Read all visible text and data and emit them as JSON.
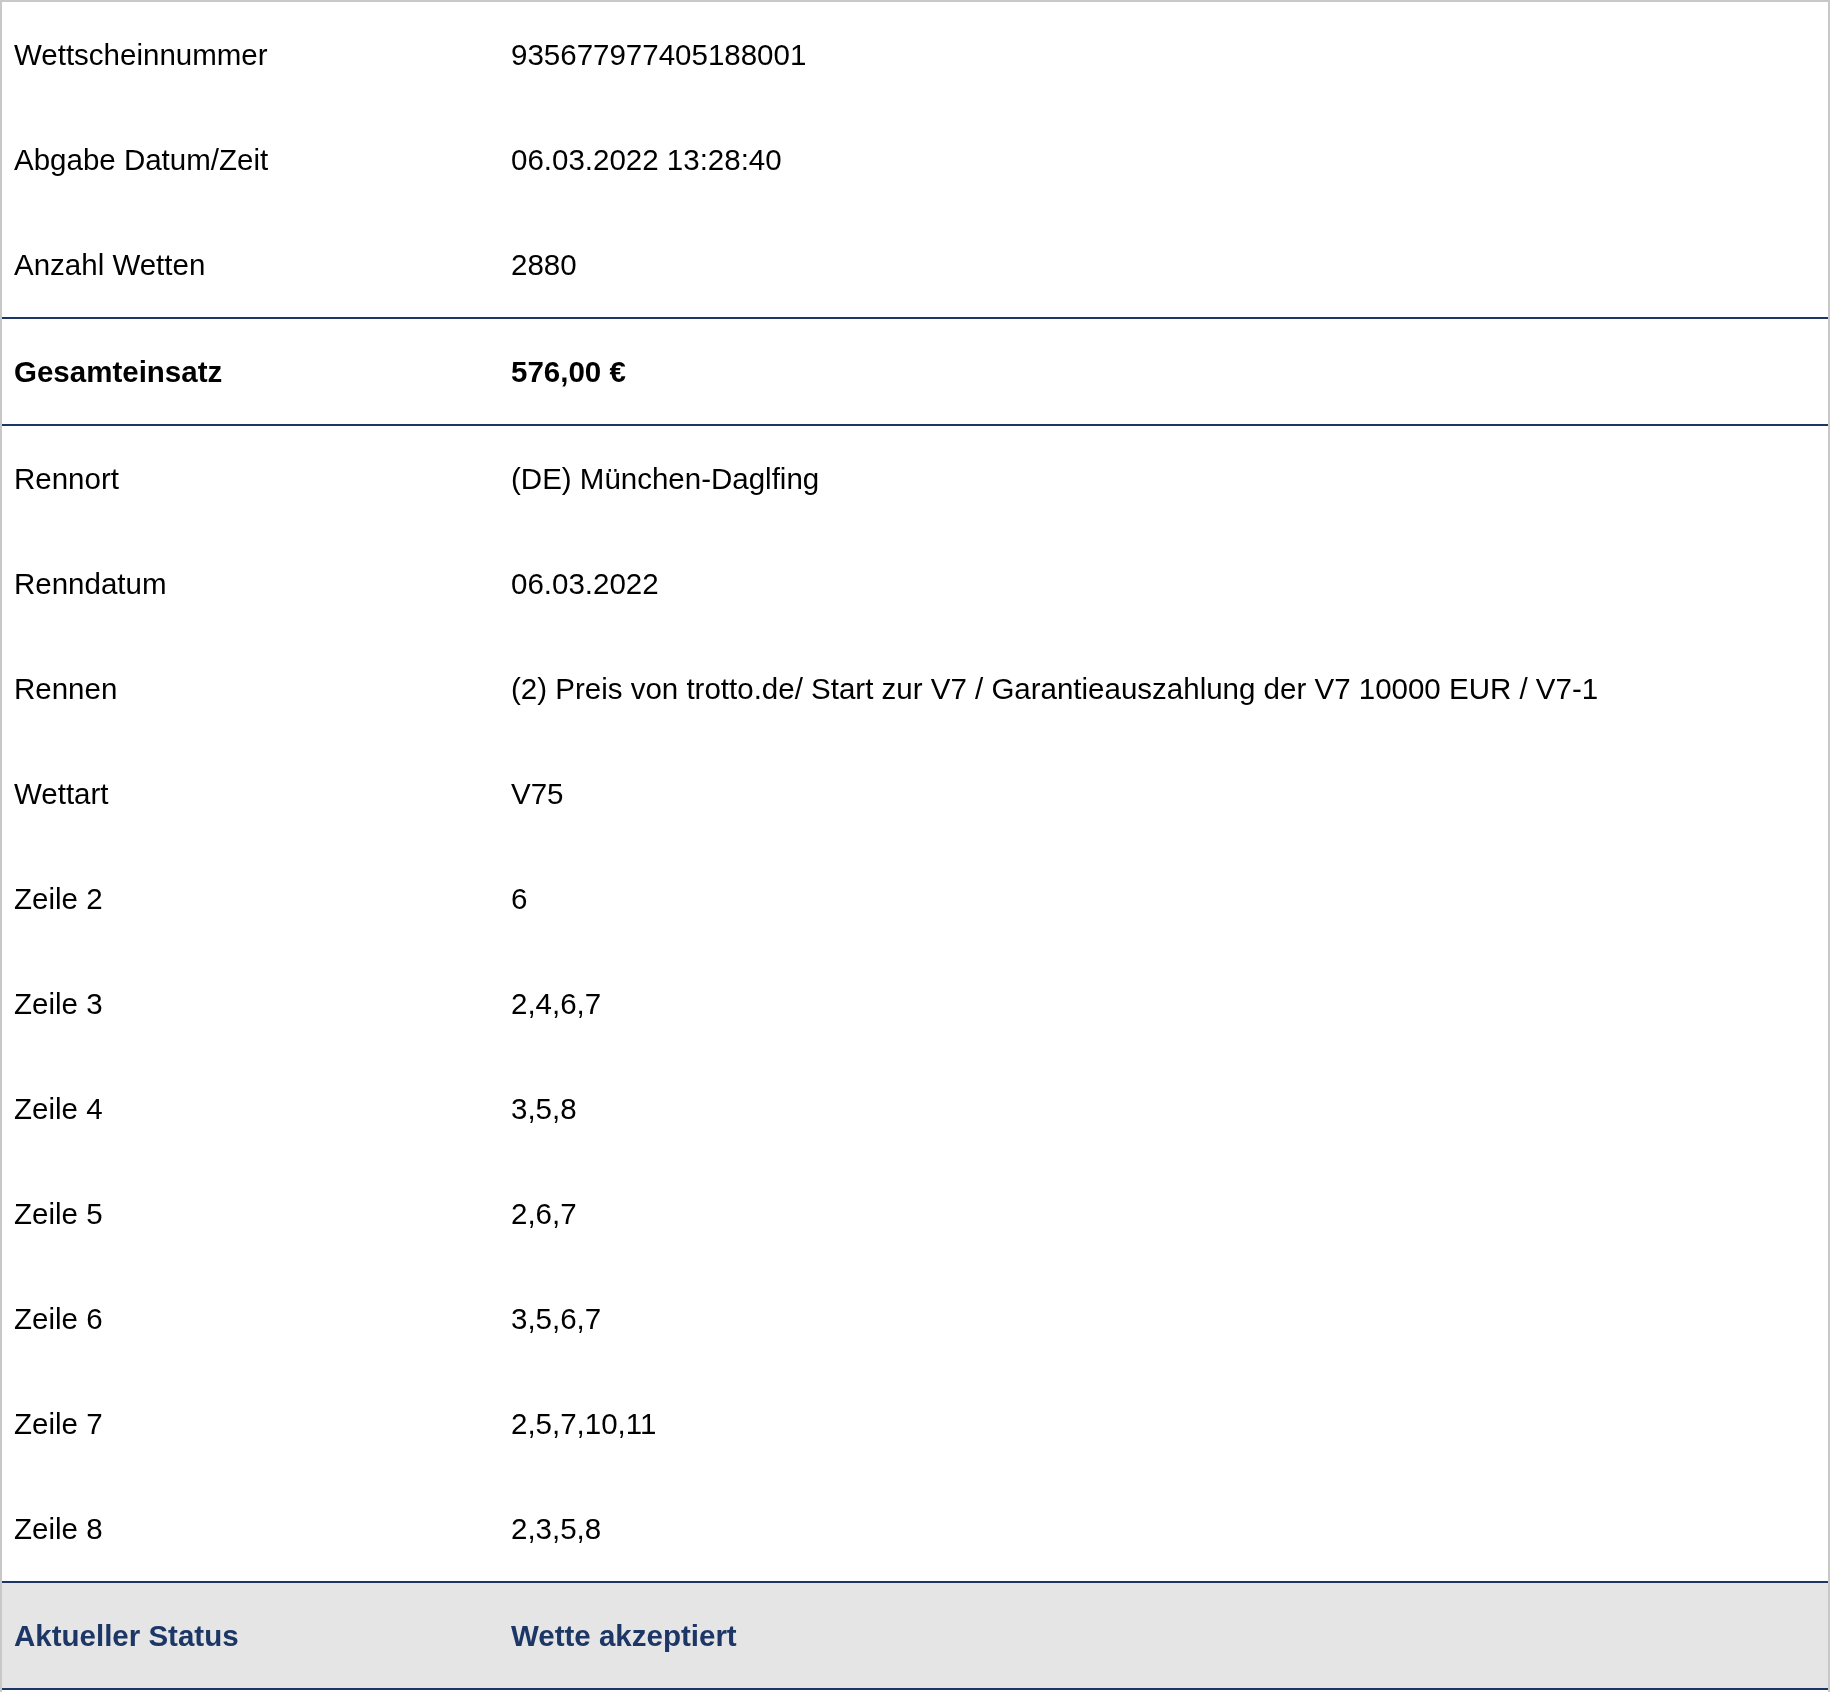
{
  "sections": [
    {
      "kind": "plain",
      "rows": [
        {
          "label": "Wettscheinnummer",
          "value": "935677977405188001"
        },
        {
          "label": "Abgabe Datum/Zeit",
          "value": "06.03.2022 13:28:40"
        },
        {
          "label": "Anzahl Wetten",
          "value": "2880"
        }
      ]
    },
    {
      "kind": "total",
      "rows": [
        {
          "label": "Gesamteinsatz",
          "value": "576,00 €"
        }
      ]
    },
    {
      "kind": "plain",
      "rows": [
        {
          "label": "Rennort",
          "value": "(DE) München-Daglfing"
        },
        {
          "label": "Renndatum",
          "value": "06.03.2022"
        },
        {
          "label": "Rennen",
          "value": "(2) Preis von trotto.de/ Start zur V7 / Garantieauszahlung der V7 10000 EUR / V7-1"
        },
        {
          "label": "Wettart",
          "value": "V75"
        },
        {
          "label": "Zeile 2",
          "value": "6"
        },
        {
          "label": "Zeile 3",
          "value": "2,4,6,7"
        },
        {
          "label": "Zeile 4",
          "value": "3,5,8"
        },
        {
          "label": "Zeile 5",
          "value": "2,6,7"
        },
        {
          "label": "Zeile 6",
          "value": "3,5,6,7"
        },
        {
          "label": "Zeile 7",
          "value": "2,5,7,10,11"
        },
        {
          "label": "Zeile 8",
          "value": "2,3,5,8"
        }
      ]
    },
    {
      "kind": "status",
      "rows": [
        {
          "label": "Aktueller Status",
          "value": "Wette akzeptiert"
        }
      ]
    }
  ]
}
